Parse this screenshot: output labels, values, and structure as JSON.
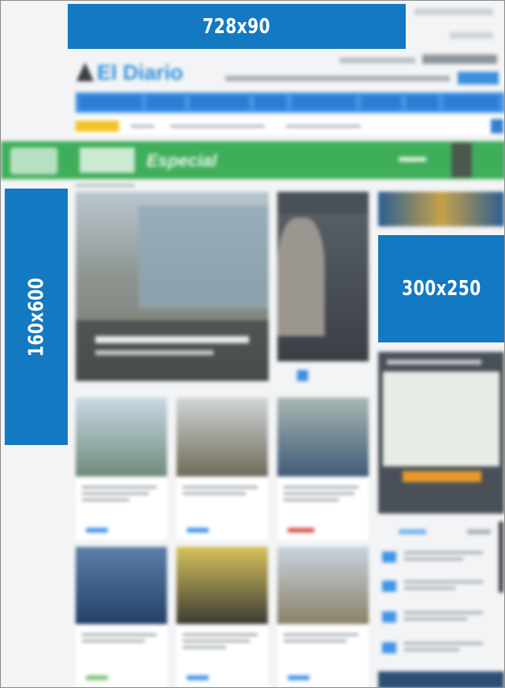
{
  "ads": {
    "leaderboard": "728x90",
    "skyscraper": "160x600",
    "rectangle": "300x250"
  },
  "site": {
    "logo_text": "El Diario",
    "banner_text": "Especial"
  },
  "colors": {
    "ad_blue": "#1279c2",
    "nav_blue": "#2e7dd4",
    "banner_green": "#3fae5a",
    "tag_yellow": "#f3c425"
  }
}
